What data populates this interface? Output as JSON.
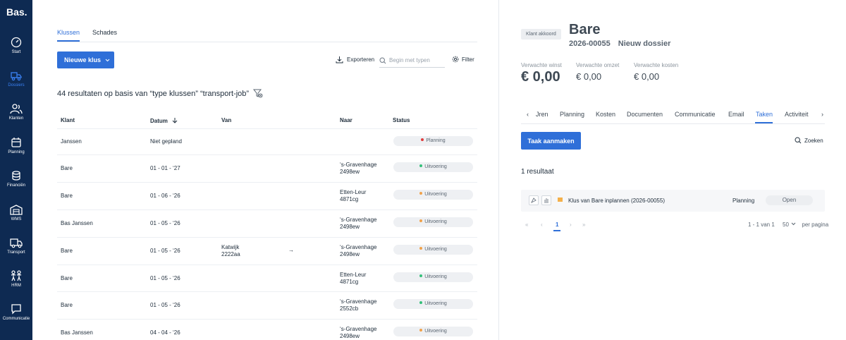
{
  "brand": {
    "logo": "Bas."
  },
  "sidebar": {
    "items": [
      {
        "label": "Start",
        "icon": "gauge-icon"
      },
      {
        "label": "Dossiers",
        "icon": "truck-scooter-icon"
      },
      {
        "label": "Klanten",
        "icon": "users-icon"
      },
      {
        "label": "Planning",
        "icon": "calendar-icon"
      },
      {
        "label": "Financiën",
        "icon": "coins-icon"
      },
      {
        "label": "WMS",
        "icon": "warehouse-icon"
      },
      {
        "label": "Transport",
        "icon": "truck-icon"
      },
      {
        "label": "HRM",
        "icon": "people-icon"
      },
      {
        "label": "Communicatie",
        "icon": "chat-icon"
      }
    ],
    "active": "Dossiers",
    "colors": {
      "bg": "#0e2a52",
      "active": "#3b82f6"
    }
  },
  "list": {
    "tabs": [
      "Klussen",
      "Schades"
    ],
    "active_tab": "Klussen",
    "new_button": "Nieuwe klus",
    "export_label": "Exporteren",
    "search_placeholder": "Begin met typen",
    "filter_label": "Filter",
    "results_text": "44 resultaten op basis van “type klussen” “transport-job”",
    "columns": [
      "Klant",
      "Datum",
      "Van",
      "Naar",
      "Status"
    ],
    "rows": [
      {
        "klant": "Janssen",
        "datum": "Niet gepland",
        "van": "",
        "van2": "",
        "naar": "",
        "naar2": "",
        "status": "Planning",
        "status_color": "#e03e3e"
      },
      {
        "klant": "Bare",
        "datum": "01 - 01 - ‘27",
        "van": "",
        "van2": "",
        "naar": "‘s-Gravenhage",
        "naar2": "2498ew",
        "status": "Uitvoering",
        "status_color": "#35c07a"
      },
      {
        "klant": "Bare",
        "datum": "01 - 06 - ‘26",
        "van": "",
        "van2": "",
        "naar": "Etten-Leur",
        "naar2": "4871cg",
        "status": "Uitvoering",
        "status_color": "#f0a24b"
      },
      {
        "klant": "Bas Janssen",
        "datum": "01 - 05 - ‘26",
        "van": "",
        "van2": "",
        "naar": "‘s-Gravenhage",
        "naar2": "2498ew",
        "status": "Uitvoering",
        "status_color": "#f0a24b"
      },
      {
        "klant": "Bare",
        "datum": "01 - 05 - ‘26",
        "van": "Katwijk",
        "van2": "2222aa",
        "naar": "‘s-Gravenhage",
        "naar2": "2498ew",
        "status": "Uitvoering",
        "status_color": "#f0a24b"
      },
      {
        "klant": "Bare",
        "datum": "01 - 05 - ‘26",
        "van": "",
        "van2": "",
        "naar": "Etten-Leur",
        "naar2": "4871cg",
        "status": "Uitvoering",
        "status_color": "#35c07a"
      },
      {
        "klant": "Bare",
        "datum": "01 - 05 - ‘26",
        "van": "",
        "van2": "",
        "naar": "‘s-Gravenhage",
        "naar2": "2552cb",
        "status": "Uitvoering",
        "status_color": "#35c07a"
      },
      {
        "klant": "Bas Janssen",
        "datum": "04 - 04 - ‘26",
        "van": "",
        "van2": "",
        "naar": "‘s-Gravenhage",
        "naar2": "2498ew",
        "status": "Uitvoering",
        "status_color": "#f0a24b"
      }
    ],
    "arrow": "→"
  },
  "detail": {
    "badge": "Klant akkoord",
    "title": "Bare",
    "dossier_no": "2026-00055",
    "dossier_type": "Nieuw dossier",
    "metrics": [
      {
        "label": "Verwachte winst",
        "value": "€ 0,00"
      },
      {
        "label": "Verwachte omzet",
        "value": "€ 0,00"
      },
      {
        "label": "Verwachte kosten",
        "value": "€ 0,00"
      }
    ],
    "tabs": [
      "Jren",
      "Planning",
      "Kosten",
      "Documenten",
      "Communicatie",
      "Email",
      "Taken",
      "Activiteit"
    ],
    "active_tab": "Taken",
    "prev_glyph": "‹",
    "next_glyph": "›",
    "task_button": "Taak aanmaken",
    "search_label": "Zoeken",
    "result_count": "1 resultaat",
    "task": {
      "name": "Klus van Bare inplannen (2026-00055)",
      "status": "Planning",
      "state": "Open"
    },
    "pager": {
      "first": "«",
      "prev": "‹",
      "current": "1",
      "next": "›",
      "last": "»",
      "info": "1 - 1 van 1",
      "per_page": "50",
      "per_page_label": "per pagina"
    }
  },
  "accent": "#2f6fd8"
}
